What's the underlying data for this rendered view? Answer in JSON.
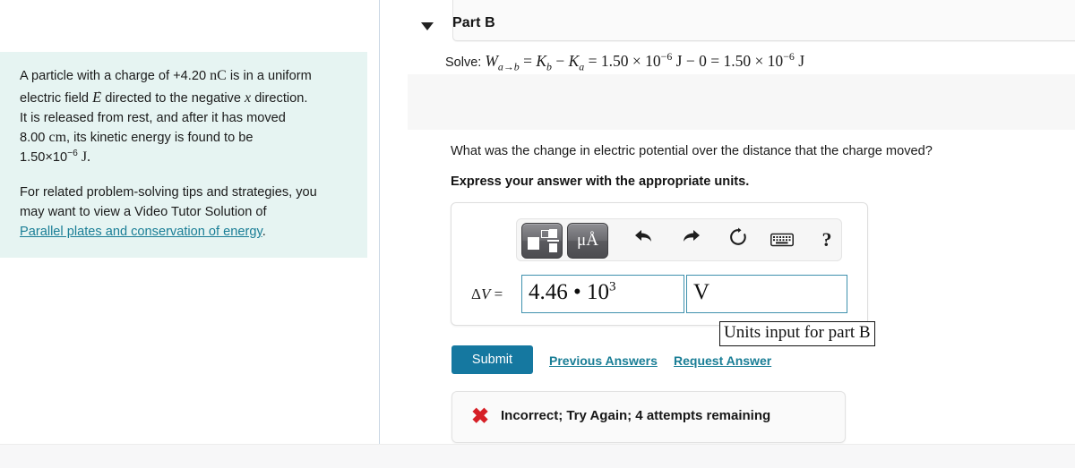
{
  "problem": {
    "text_line1_a": "A particle with a charge of +4.20 ",
    "unit_nC": "nC",
    "text_line1_b": " is in a uniform",
    "text_line2_a": "electric field ",
    "symbol_E": "E",
    "text_line2_b": " directed to the negative ",
    "symbol_x": "x",
    "text_line2_c": " direction.",
    "text_line3": "It is released from rest, and after it has moved",
    "text_line4_a": "8.00 ",
    "unit_cm": "cm",
    "text_line4_b": ", its kinetic energy is found to be",
    "text_line5_mantissa": "1.50×10",
    "text_line5_exp": "−6",
    "text_line5_unit": " J.",
    "para2_line1": "For related problem-solving tips and strategies, you",
    "para2_line2": "may want to view a Video Tutor Solution of",
    "tutor_link": "Parallel plates and conservation of energy",
    "para2_end": "."
  },
  "solve": {
    "label": "Solve:",
    "W": "W",
    "W_sub": "a→b",
    "eq1": " = ",
    "Kb": "K",
    "Kb_sub": "b",
    "minus": " − ",
    "Ka": "K",
    "Ka_sub": "a",
    "eq2": " = 1.50 × 10",
    "exp1": "−6",
    "mid": " J − 0 = 1.50 × 10",
    "exp2": "−6",
    "tail": " J"
  },
  "part": {
    "title": "Part B",
    "caret_icon": "triangle-down-icon",
    "question": "What was the change in electric potential over the distance that the charge moved?",
    "express": "Express your answer with the appropriate units."
  },
  "toolbar": {
    "template_button_name": "math-template-button",
    "units_button_label": "μÅ",
    "undo_icon": "⬅",
    "redo_icon": "➡",
    "reset_icon": "↻",
    "keyboard_icon": "keyboard-icon",
    "help_icon": "?"
  },
  "answer": {
    "label_delta": "Δ",
    "label_V": "V",
    "label_eq": " =",
    "value": "4.46 • 10",
    "value_exp": "3",
    "value_placeholder": "",
    "units": "V",
    "units_placeholder": ""
  },
  "annotation": {
    "text": "Units input for part B"
  },
  "actions": {
    "submit": "Submit",
    "previous_answers": "Previous Answers",
    "request_answer": "Request Answer"
  },
  "feedback": {
    "icon": "✖",
    "icon_name": "incorrect-x-icon",
    "text": "Incorrect; Try Again; 4 attempts remaining"
  },
  "colors": {
    "panel_bg": "#e6f4f2",
    "link": "#1a7e96",
    "submit_bg": "#1578a0",
    "field_border": "#3f91ad",
    "error": "#d61f26",
    "header_band": "#f7f7f7"
  }
}
